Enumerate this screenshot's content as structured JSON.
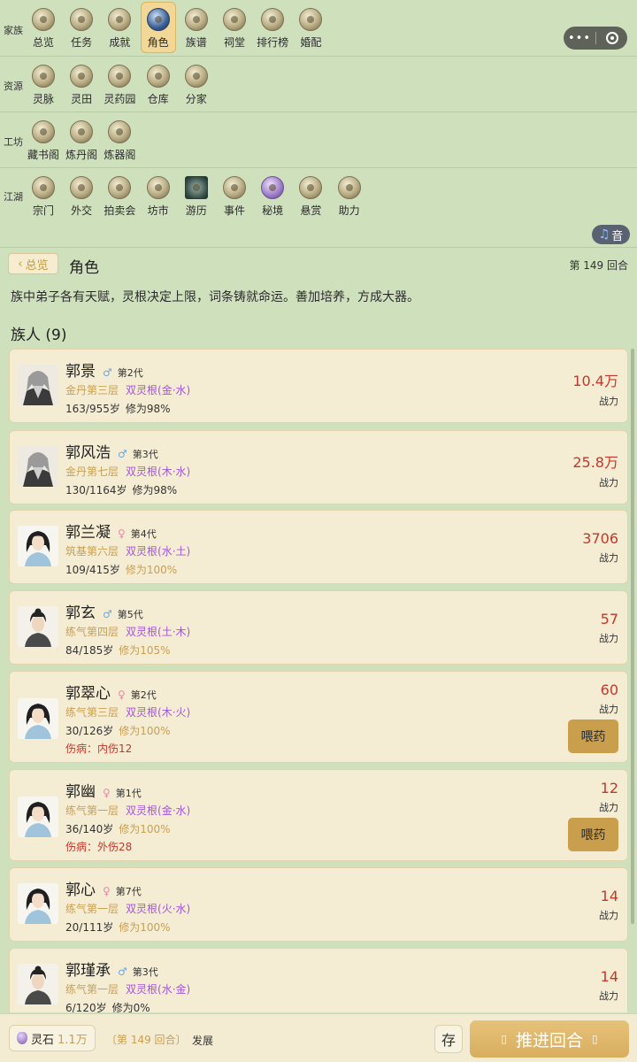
{
  "capsule": {
    "more_icon": "more-dots-icon",
    "close_icon": "record-circle-icon"
  },
  "nav": {
    "rows": [
      {
        "label": "家族",
        "items": [
          {
            "label": "总览",
            "icon": "overview-icon"
          },
          {
            "label": "任务",
            "icon": "task-icon"
          },
          {
            "label": "成就",
            "icon": "achievement-icon"
          },
          {
            "label": "角色",
            "icon": "character-icon",
            "active": true
          },
          {
            "label": "族谱",
            "icon": "genealogy-icon"
          },
          {
            "label": "祠堂",
            "icon": "shrine-icon"
          },
          {
            "label": "排行榜",
            "icon": "ranking-icon"
          },
          {
            "label": "婚配",
            "icon": "marriage-icon"
          }
        ]
      },
      {
        "label": "资源",
        "items": [
          {
            "label": "灵脉",
            "icon": "spirit-vein-icon"
          },
          {
            "label": "灵田",
            "icon": "spirit-field-icon"
          },
          {
            "label": "灵药园",
            "icon": "herb-garden-icon"
          },
          {
            "label": "仓库",
            "icon": "warehouse-icon"
          },
          {
            "label": "分家",
            "icon": "split-family-icon"
          }
        ]
      },
      {
        "label": "工坊",
        "items": [
          {
            "label": "藏书阁",
            "icon": "library-icon"
          },
          {
            "label": "炼丹阁",
            "icon": "alchemy-icon"
          },
          {
            "label": "炼器阁",
            "icon": "forge-icon"
          }
        ]
      },
      {
        "label": "江湖",
        "items": [
          {
            "label": "宗门",
            "icon": "sect-icon"
          },
          {
            "label": "外交",
            "icon": "diplomacy-icon"
          },
          {
            "label": "拍卖会",
            "icon": "auction-icon"
          },
          {
            "label": "坊市",
            "icon": "market-icon"
          },
          {
            "label": "游历",
            "icon": "travel-icon"
          },
          {
            "label": "事件",
            "icon": "event-icon"
          },
          {
            "label": "秘境",
            "icon": "secret-realm-icon"
          },
          {
            "label": "悬赏",
            "icon": "bounty-icon"
          },
          {
            "label": "助力",
            "icon": "assist-icon"
          }
        ]
      }
    ]
  },
  "sound": {
    "label": "音",
    "icon": "music-note-icon"
  },
  "header": {
    "back_label": "总览",
    "title": "角色",
    "round": "第 149 回合"
  },
  "intro": "族中弟子各有天赋，灵根决定上限，词条铸就命运。善加培养，方成大器。",
  "members_title": "族人 (9)",
  "members": [
    {
      "name": "郭景",
      "gender": "♂",
      "gen": "第2代",
      "realm": "金丹第三层",
      "root": "双灵根(金·水)",
      "age": "163/955岁",
      "cult": "修为98%",
      "cult_full": false,
      "injury": "",
      "power": "10.4万",
      "power_label": "战力",
      "action": ""
    },
    {
      "name": "郭风浩",
      "gender": "♂",
      "gen": "第3代",
      "realm": "金丹第七层",
      "root": "双灵根(木·水)",
      "age": "130/1164岁",
      "cult": "修为98%",
      "cult_full": false,
      "injury": "",
      "power": "25.8万",
      "power_label": "战力",
      "action": ""
    },
    {
      "name": "郭兰凝",
      "gender": "♀",
      "gen": "第4代",
      "realm": "筑基第六层",
      "root": "双灵根(水·土)",
      "age": "109/415岁",
      "cult": "修为100%",
      "cult_full": true,
      "injury": "",
      "power": "3706",
      "power_label": "战力",
      "action": ""
    },
    {
      "name": "郭玄",
      "gender": "♂",
      "gen": "第5代",
      "realm": "练气第四层",
      "root": "双灵根(土·木)",
      "age": "84/185岁",
      "cult": "修为105%",
      "cult_full": true,
      "injury": "",
      "power": "57",
      "power_label": "战力",
      "action": ""
    },
    {
      "name": "郭翠心",
      "gender": "♀",
      "gen": "第2代",
      "realm": "练气第三层",
      "root": "双灵根(木·火)",
      "age": "30/126岁",
      "cult": "修为100%",
      "cult_full": true,
      "injury": "伤病：内伤12",
      "power": "60",
      "power_label": "战力",
      "action": "喂药"
    },
    {
      "name": "郭幽",
      "gender": "♀",
      "gen": "第1代",
      "realm": "练气第一层",
      "root": "双灵根(金·水)",
      "age": "36/140岁",
      "cult": "修为100%",
      "cult_full": true,
      "injury": "伤病：外伤28",
      "power": "12",
      "power_label": "战力",
      "action": "喂药"
    },
    {
      "name": "郭心",
      "gender": "♀",
      "gen": "第7代",
      "realm": "练气第一层",
      "root": "双灵根(火·水)",
      "age": "20/111岁",
      "cult": "修为100%",
      "cult_full": true,
      "injury": "",
      "power": "14",
      "power_label": "战力",
      "action": ""
    },
    {
      "name": "郭瑾承",
      "gender": "♂",
      "gen": "第3代",
      "realm": "练气第一层",
      "root": "双灵根(水·金)",
      "age": "6/120岁",
      "cult": "修为0%",
      "cult_full": false,
      "injury": "",
      "power": "14",
      "power_label": "战力",
      "action": ""
    }
  ],
  "bottom": {
    "stone_label": "灵石",
    "stone_amount": "1.1万",
    "round": "〔第 149 回合〕",
    "phase": "发展",
    "save_label": "存",
    "advance_label": "推进回合",
    "advance_glyph_left": "▯",
    "advance_glyph_right": "▯"
  },
  "colors": {
    "background": "#cfe0bd",
    "card": "#f5ecd4",
    "power": "#c0392b",
    "realm": "#c8a052",
    "root": "#a256d6",
    "injury": "#c2392b",
    "advance": "#d8ae5f"
  }
}
